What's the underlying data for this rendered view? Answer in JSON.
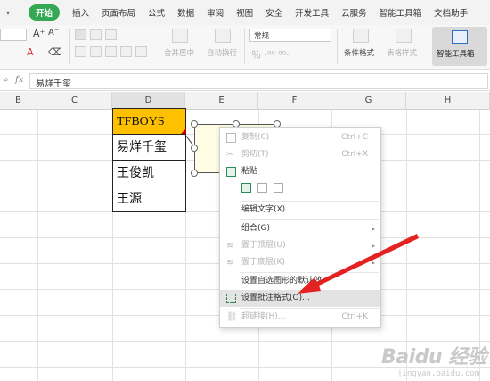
{
  "menubar": {
    "tabs": [
      "开始",
      "插入",
      "页面布局",
      "公式",
      "数据",
      "审阅",
      "视图",
      "安全",
      "开发工具",
      "云服务",
      "智能工具箱",
      "文档助手"
    ],
    "active_color": "#34a853"
  },
  "ribbon": {
    "font_bigger": "A⁺",
    "font_smaller": "A⁻",
    "merge_center": "合并居中",
    "auto_wrap": "自动换行",
    "number_format": "常规",
    "cond_format": "条件格式",
    "table_style": "表格样式",
    "smart_toolbox": "智能工具箱"
  },
  "formula_bar": {
    "fx": "fx",
    "value": "易烊千玺"
  },
  "columns": [
    "B",
    "C",
    "D",
    "E",
    "F",
    "G",
    "H"
  ],
  "cells": [
    "TFBOYS",
    "易烊千玺",
    "王俊凯",
    "王源"
  ],
  "cell_fill": "#ffc000",
  "context_menu": {
    "items": [
      {
        "label": "复制(C)",
        "shortcut": "Ctrl+C"
      },
      {
        "label": "剪切(T)",
        "shortcut": "Ctrl+X"
      },
      {
        "label": "粘贴",
        "shortcut": ""
      },
      {
        "label": "编辑文字(X)",
        "shortcut": ""
      },
      {
        "label": "组合(G)",
        "shortcut": ""
      },
      {
        "label": "置于顶层(U)",
        "shortcut": ""
      },
      {
        "label": "置于底层(K)",
        "shortcut": ""
      },
      {
        "label": "设置自选图形的默认效",
        "shortcut": ""
      },
      {
        "label": "设置批注格式(O)...",
        "shortcut": ""
      },
      {
        "label": "超链接(H)...",
        "shortcut": "Ctrl+K"
      }
    ]
  },
  "arrow_color": "#e52222",
  "watermark": {
    "main": "Baidu 经验",
    "sub": "jingyan.baidu.com"
  }
}
